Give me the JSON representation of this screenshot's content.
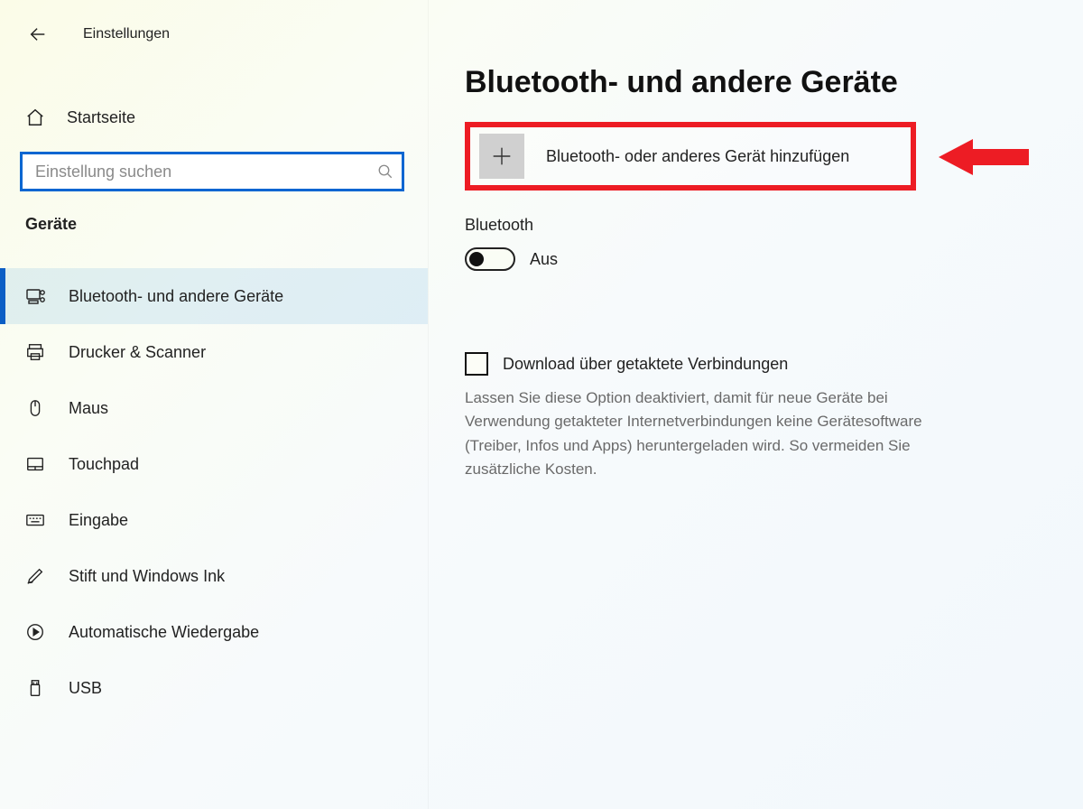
{
  "header": {
    "title": "Einstellungen"
  },
  "sidebar": {
    "home_label": "Startseite",
    "search_placeholder": "Einstellung suchen",
    "section_label": "Geräte",
    "items": [
      {
        "label": "Bluetooth- und andere Geräte"
      },
      {
        "label": "Drucker & Scanner"
      },
      {
        "label": "Maus"
      },
      {
        "label": "Touchpad"
      },
      {
        "label": "Eingabe"
      },
      {
        "label": "Stift und Windows Ink"
      },
      {
        "label": "Automatische Wiedergabe"
      },
      {
        "label": "USB"
      }
    ]
  },
  "main": {
    "title": "Bluetooth- und andere Geräte",
    "add_device_label": "Bluetooth- oder anderes Gerät hinzufügen",
    "bluetooth_header": "Bluetooth",
    "bluetooth_state": "Aus",
    "metered_checkbox_label": "Download über getaktete Verbindungen",
    "metered_description": "Lassen Sie diese Option deaktiviert, damit für neue Geräte bei Verwendung getakteter Internetverbindungen keine Gerätesoftware (Treiber, Infos und Apps) heruntergeladen wird. So vermeiden Sie zusätzliche Kosten."
  }
}
